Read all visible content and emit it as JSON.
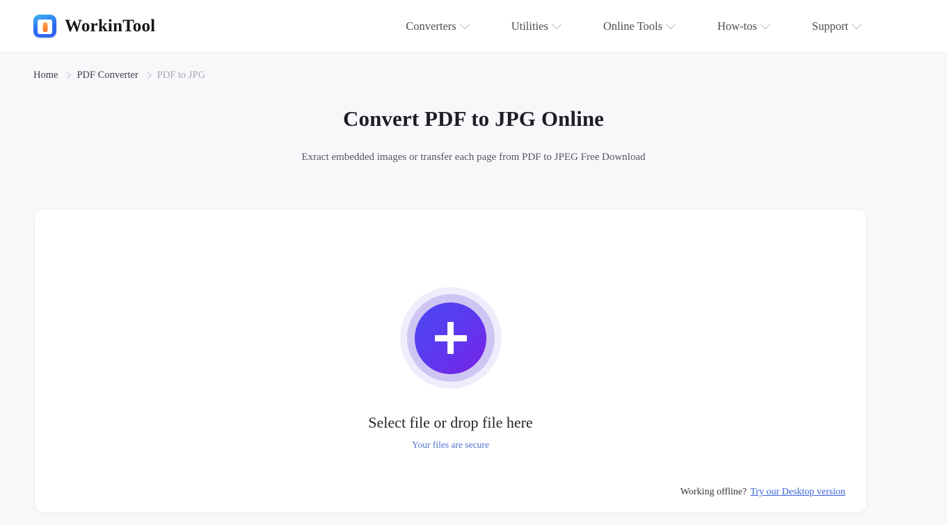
{
  "header": {
    "brand_name": "WorkinTool",
    "logo_icon": "workintool-logo-icon",
    "nav": [
      {
        "label": "Converters",
        "icon": "chevron-down-icon"
      },
      {
        "label": "Utilities",
        "icon": "chevron-down-icon"
      },
      {
        "label": "Online Tools",
        "icon": "chevron-down-icon"
      },
      {
        "label": "How-tos",
        "icon": "chevron-down-icon"
      },
      {
        "label": "Support",
        "icon": "chevron-down-icon"
      }
    ]
  },
  "breadcrumb": {
    "items": [
      {
        "label": "Home"
      },
      {
        "label": "PDF Converter"
      },
      {
        "label": "PDF to JPG"
      }
    ]
  },
  "hero": {
    "title": "Convert PDF to JPG Online",
    "subtitle": "Exract embedded images or transfer each page from PDF to JPEG Free Download"
  },
  "dropzone": {
    "plus_icon": "plus-icon",
    "title": "Select file or drop file here",
    "secure_note": "Your files are secure",
    "offline_text": "Working offline?",
    "offline_link": "Try our Desktop version"
  },
  "colors": {
    "page_background": "#f7f8fa",
    "header_background": "#ffffff",
    "accent_blue": "#4b46f2",
    "accent_purple": "#7a22e4",
    "link_blue": "#3a63d8",
    "secure_blue": "#4e72cf",
    "logo_blue": "#2f6bf0",
    "logo_orange": "#f5792a"
  }
}
